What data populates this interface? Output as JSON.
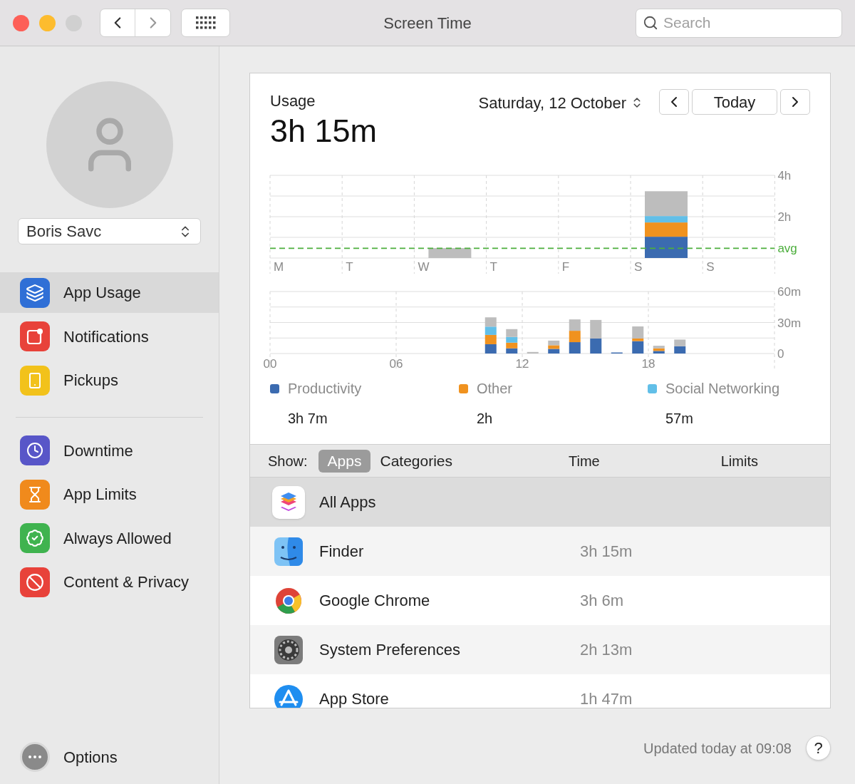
{
  "window": {
    "title": "Screen Time"
  },
  "search": {
    "placeholder": "Search"
  },
  "user": {
    "name": "Boris Savc"
  },
  "sidebar": {
    "groups": [
      [
        {
          "label": "App Usage",
          "selected": true
        },
        {
          "label": "Notifications",
          "selected": false
        },
        {
          "label": "Pickups",
          "selected": false
        }
      ],
      [
        {
          "label": "Downtime",
          "selected": false
        },
        {
          "label": "App Limits",
          "selected": false
        },
        {
          "label": "Always Allowed",
          "selected": false
        },
        {
          "label": "Content & Privacy",
          "selected": false
        }
      ]
    ],
    "options": "Options"
  },
  "usage": {
    "label": "Usage",
    "total": "3h 15m",
    "date": "Saturday, 12 October",
    "today_button": "Today",
    "weekly": {
      "chart_data": {
        "type": "bar",
        "stacked": true,
        "categories": [
          "M",
          "T",
          "W",
          "T",
          "F",
          "S",
          "S"
        ],
        "ylim": [
          0,
          4
        ],
        "yticks": [
          {
            "value": 2,
            "label": "2h"
          },
          {
            "value": 4,
            "label": "4h"
          }
        ],
        "grid": true,
        "ref_lines": [
          {
            "axis": "y",
            "value": 0.47,
            "label": "avg"
          }
        ],
        "series": [
          {
            "color": "#3b6bb0",
            "values": [
              0,
              0,
              0,
              0,
              0,
              1.03,
              0
            ]
          },
          {
            "color": "#f0921f",
            "values": [
              0,
              0,
              0,
              0,
              0,
              0.69,
              0
            ]
          },
          {
            "color": "#62bfe8",
            "values": [
              0,
              0,
              0,
              0,
              0,
              0.31,
              0
            ]
          },
          {
            "color": "#bdbdbd",
            "values": [
              0,
              0,
              0.48,
              0,
              0,
              1.2,
              0
            ]
          }
        ]
      }
    },
    "hourly": {
      "chart_data": {
        "type": "bar",
        "stacked": true,
        "x": [
          10.5,
          11.5,
          12.5,
          13.5,
          14.5,
          15.5,
          16.5,
          17.5,
          18.5,
          19.5
        ],
        "grid": true,
        "xlim": [
          0,
          24
        ],
        "xticks": [
          {
            "value": 0,
            "label": "00"
          },
          {
            "value": 6,
            "label": "06"
          },
          {
            "value": 12,
            "label": "12"
          },
          {
            "value": 18,
            "label": "18"
          }
        ],
        "ylim": [
          0,
          60
        ],
        "yticks": [
          {
            "value": 0,
            "label": "0"
          },
          {
            "value": 30,
            "label": "30m"
          },
          {
            "value": 60,
            "label": "60m"
          }
        ],
        "series": [
          {
            "color": "#3b6bb0",
            "values": [
              9,
              5,
              0,
              4.5,
              11,
              14.5,
              1,
              12,
              2.5,
              7
            ]
          },
          {
            "color": "#f0921f",
            "values": [
              9,
              5.5,
              0,
              3.5,
              11,
              0,
              0,
              2.5,
              2.5,
              0
            ]
          },
          {
            "color": "#62bfe8",
            "values": [
              8,
              5.5,
              0,
              0,
              0,
              0,
              0,
              0,
              0,
              0
            ]
          },
          {
            "color": "#bdbdbd",
            "values": [
              9,
              7.6,
              1.5,
              4.5,
              11,
              18,
              0,
              11.7,
              2.5,
              6.5
            ]
          }
        ]
      }
    },
    "legend": [
      {
        "name": "Productivity",
        "color": "#3b6bb0",
        "value": "3h 7m"
      },
      {
        "name": "Other",
        "color": "#f0921f",
        "value": "2h"
      },
      {
        "name": "Social Networking",
        "color": "#62bfe8",
        "value": "57m"
      }
    ]
  },
  "table": {
    "show_label": "Show:",
    "segments": [
      {
        "label": "Apps",
        "selected": true
      },
      {
        "label": "Categories",
        "selected": false
      }
    ],
    "columns": [
      "Time",
      "Limits"
    ],
    "rows": [
      {
        "name": "All Apps",
        "selected": true
      },
      {
        "name": "Finder",
        "time": "3h 15m",
        "selected": false
      },
      {
        "name": "Google Chrome",
        "time": "3h 6m",
        "selected": false
      },
      {
        "name": "System Preferences",
        "time": "2h 13m",
        "selected": false
      },
      {
        "name": "App Store",
        "time": "1h 47m",
        "selected": false
      }
    ]
  },
  "footer": {
    "updated": "Updated today at 09:08",
    "help": "?"
  }
}
